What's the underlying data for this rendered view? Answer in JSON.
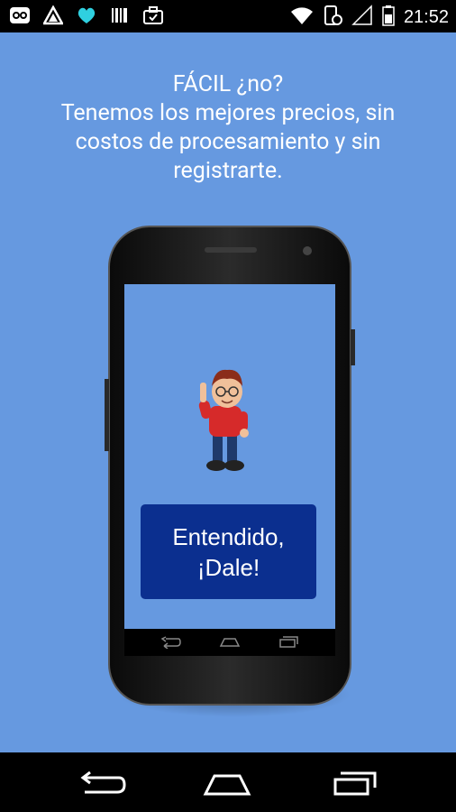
{
  "status_bar": {
    "time": "21:52",
    "left_icons": [
      "voicemail-icon",
      "triangle-app-icon",
      "heart-icon",
      "barcode-icon",
      "briefcase-icon"
    ],
    "right_icons": [
      "wifi-icon",
      "phone-sync-icon",
      "signal-icon",
      "battery-icon"
    ]
  },
  "message": {
    "line1": "FÁCIL ¿no?",
    "line2": "Tenemos los mejores precios, sin",
    "line3": "costos de procesamiento y sin",
    "line4": "registrarte."
  },
  "cta": {
    "line1": "Entendido,",
    "line2": "¡Dale!"
  },
  "colors": {
    "background": "#6699e0",
    "button": "#0b2f8f",
    "text": "#ffffff"
  },
  "nav": {
    "buttons": [
      "back-icon",
      "home-icon",
      "recent-apps-icon"
    ]
  }
}
